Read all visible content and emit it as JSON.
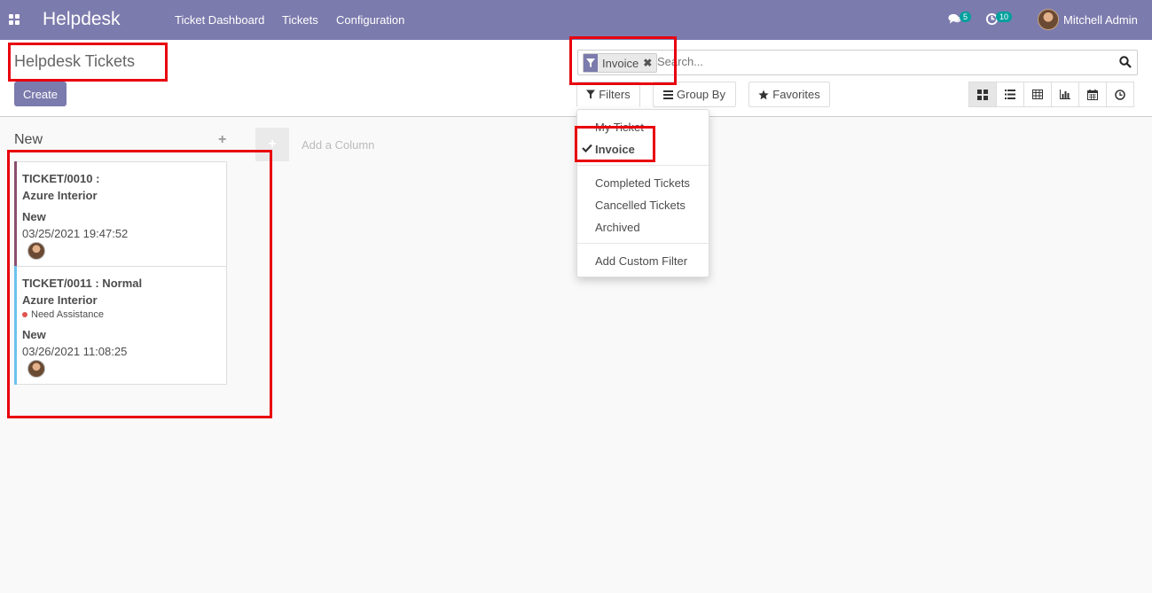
{
  "navbar": {
    "brand": "Helpdesk",
    "menu": [
      "Ticket Dashboard",
      "Tickets",
      "Configuration"
    ],
    "messages_count": "5",
    "activities_count": "10",
    "user": "Mitchell Admin"
  },
  "control_panel": {
    "breadcrumb": "Helpdesk Tickets",
    "create_label": "Create",
    "search": {
      "facet_label": "Invoice",
      "placeholder": "Search..."
    },
    "filters_label": "Filters",
    "group_by_label": "Group By",
    "favorites_label": "Favorites"
  },
  "filters_menu": {
    "items": [
      "My Ticket",
      "Invoice",
      "Completed Tickets",
      "Cancelled Tickets",
      "Archived",
      "Add Custom Filter"
    ]
  },
  "kanban": {
    "column_title": "New",
    "add_column_label": "Add a Column",
    "cards": [
      {
        "title": "TICKET/0010 :",
        "customer": "Azure Interior",
        "tag": "",
        "stage": "New",
        "date": "03/25/2021 19:47:52",
        "bar_color": "#8b4f6e"
      },
      {
        "title": "TICKET/0011 : Normal",
        "customer": "Azure Interior",
        "tag": "Need Assistance",
        "stage": "New",
        "date": "03/26/2021 11:08:25",
        "bar_color": "#6cc1ed"
      }
    ]
  },
  "colors": {
    "brand": "#7c7bad",
    "badge": "#00a09d",
    "highlight": "#e8000d"
  }
}
